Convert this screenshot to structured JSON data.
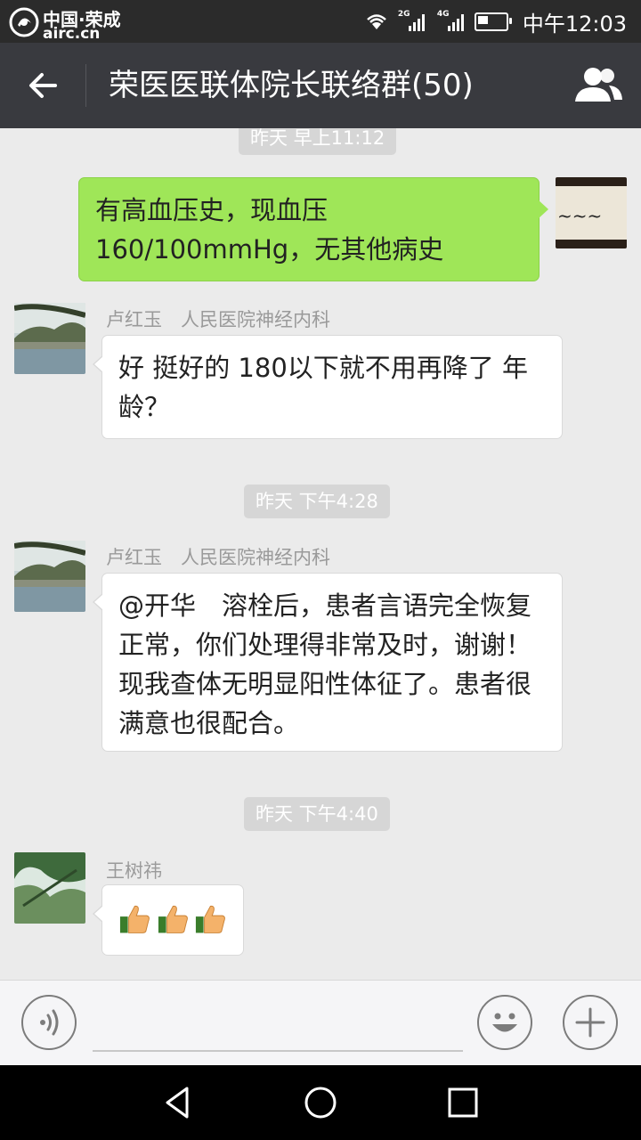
{
  "status_bar": {
    "watermark_line1": "中国·荣成",
    "watermark_line2": "airc.cn",
    "net1": "2G",
    "net2": "4G",
    "time": "中午12:03"
  },
  "header": {
    "title": "荣医医联体院长联络群(50)",
    "back_icon": "arrow-left-icon",
    "members_icon": "group-members-icon"
  },
  "messages": [
    {
      "type": "time",
      "text": "昨天 早上11:12"
    },
    {
      "type": "outgoing",
      "text": "有高血压史，现血压160/100mmHg，无其他病史",
      "avatar": "calligraphy-avatar"
    },
    {
      "type": "incoming",
      "sender": "卢红玉　人民医院神经内科",
      "text": "好  挺好的 180以下就不用再降了 年龄？",
      "avatar": "landscape-avatar"
    },
    {
      "type": "time",
      "text": "昨天 下午4:28"
    },
    {
      "type": "incoming",
      "sender": "卢红玉　人民医院神经内科",
      "text": "@开华　溶栓后，患者言语完全恢复正常，你们处理得非常及时，谢谢！现我查体无明显阳性体征了。患者很满意也很配合。",
      "avatar": "landscape-avatar"
    },
    {
      "type": "time",
      "text": "昨天 下午4:40"
    },
    {
      "type": "incoming",
      "sender": "王树祎",
      "emoji": [
        "thumbs-up-icon",
        "thumbs-up-icon",
        "thumbs-up-icon"
      ],
      "avatar": "trees-avatar"
    }
  ],
  "input_bar": {
    "voice_icon": "voice-mode-icon",
    "emoji_icon": "emoji-smile-icon",
    "plus_icon": "plus-icon"
  },
  "nav_bar": {
    "back": "nav-back-icon",
    "home": "nav-home-icon",
    "recents": "nav-recents-icon"
  },
  "colors": {
    "title_bar": "#393a3f",
    "status_bar": "#2b2b2b",
    "chat_bg": "#ebebeb",
    "outgoing_bubble": "#9fe658",
    "incoming_bubble": "#ffffff",
    "time_pill": "#d6d6d6"
  }
}
